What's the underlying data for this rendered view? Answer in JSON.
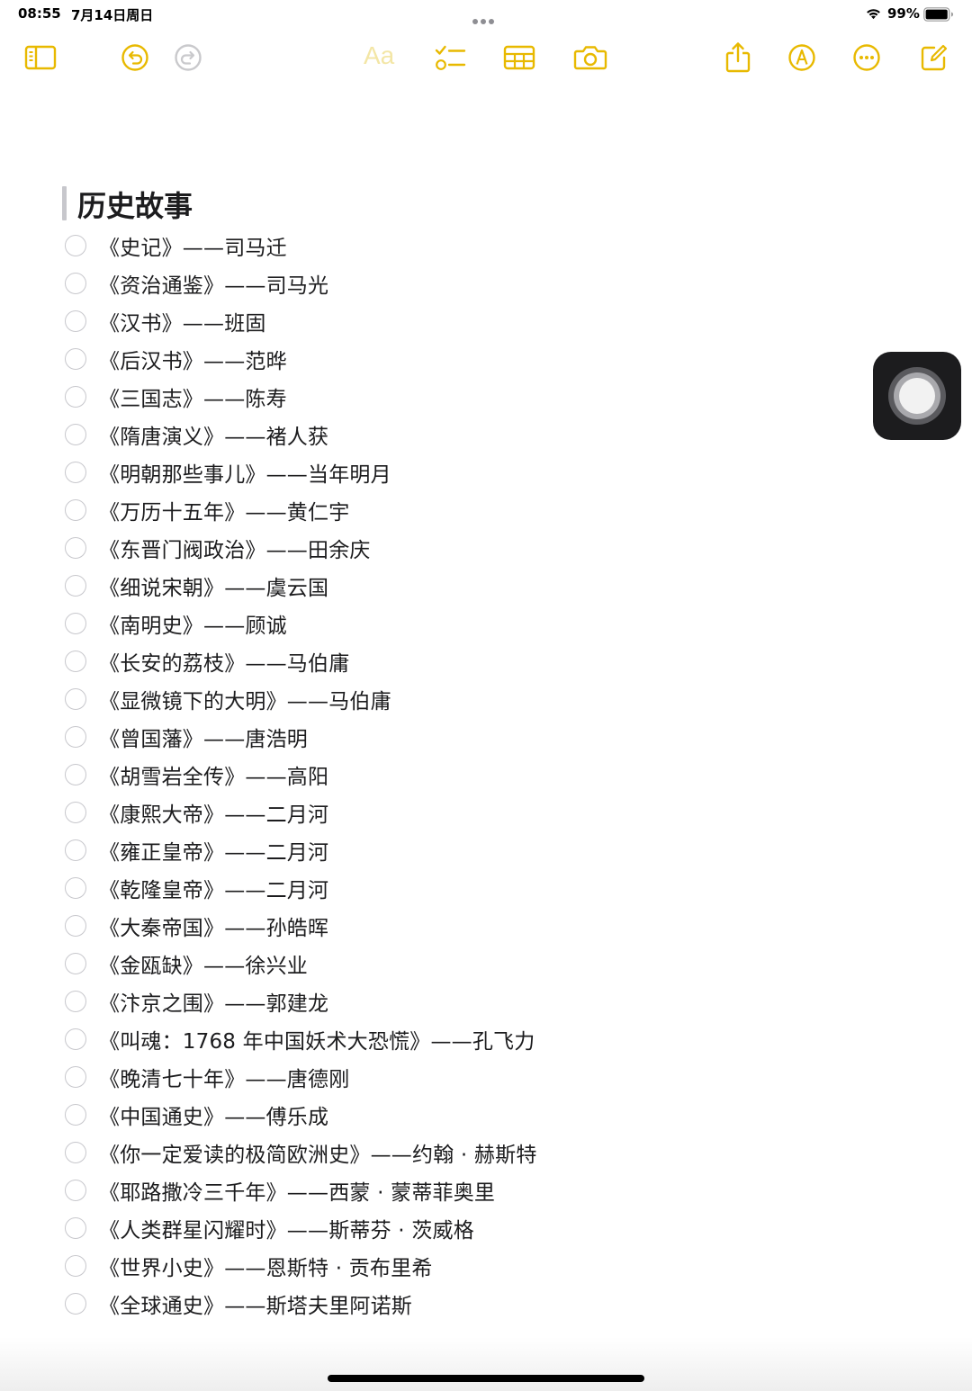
{
  "status_bar": {
    "time": "08:55",
    "date": "7月14日周日",
    "battery_percent": "99%",
    "battery_level": 0.99
  },
  "toolbar": {
    "accent_color": "#e8b900",
    "format_label": "Aa",
    "icons": [
      "sidebar-icon",
      "undo-icon",
      "redo-icon",
      "format-icon",
      "checklist-icon",
      "table-icon",
      "camera-icon",
      "share-icon",
      "markup-icon",
      "more-icon",
      "compose-icon"
    ]
  },
  "note": {
    "title": "历史故事",
    "items": [
      {
        "text": "《史记》——司马迁",
        "checked": false
      },
      {
        "text": "《资治通鉴》——司马光",
        "checked": false
      },
      {
        "text": "《汉书》——班固",
        "checked": false
      },
      {
        "text": "《后汉书》——范晔",
        "checked": false
      },
      {
        "text": "《三国志》——陈寿",
        "checked": false
      },
      {
        "text": "《隋唐演义》——褚人获",
        "checked": false
      },
      {
        "text": "《明朝那些事儿》——当年明月",
        "checked": false
      },
      {
        "text": "《万历十五年》——黄仁宇",
        "checked": false
      },
      {
        "text": "《东晋门阀政治》——田余庆",
        "checked": false
      },
      {
        "text": "《细说宋朝》——虞云国",
        "checked": false
      },
      {
        "text": "《南明史》——顾诚",
        "checked": false
      },
      {
        "text": "《长安的荔枝》——马伯庸",
        "checked": false
      },
      {
        "text": "《显微镜下的大明》——马伯庸",
        "checked": false
      },
      {
        "text": "《曾国藩》——唐浩明",
        "checked": false
      },
      {
        "text": "《胡雪岩全传》——高阳",
        "checked": false
      },
      {
        "text": "《康熙大帝》——二月河",
        "checked": false
      },
      {
        "text": "《雍正皇帝》——二月河",
        "checked": false
      },
      {
        "text": "《乾隆皇帝》——二月河",
        "checked": false
      },
      {
        "text": "《大秦帝国》——孙皓晖",
        "checked": false
      },
      {
        "text": "《金瓯缺》——徐兴业",
        "checked": false
      },
      {
        "text": "《汴京之围》——郭建龙",
        "checked": false
      },
      {
        "text": "《叫魂：1768 年中国妖术大恐慌》——孔飞力",
        "checked": false
      },
      {
        "text": "《晚清七十年》——唐德刚",
        "checked": false
      },
      {
        "text": "《中国通史》——傅乐成",
        "checked": false
      },
      {
        "text": "《你一定爱读的极简欧洲史》——约翰 · 赫斯特",
        "checked": false
      },
      {
        "text": "《耶路撒冷三千年》——西蒙 · 蒙蒂菲奥里",
        "checked": false
      },
      {
        "text": "《人类群星闪耀时》——斯蒂芬 · 茨威格",
        "checked": false
      },
      {
        "text": "《世界小史》——恩斯特 · 贡布里希",
        "checked": false
      },
      {
        "text": "《全球通史》——斯塔夫里阿诺斯",
        "checked": false
      }
    ]
  }
}
